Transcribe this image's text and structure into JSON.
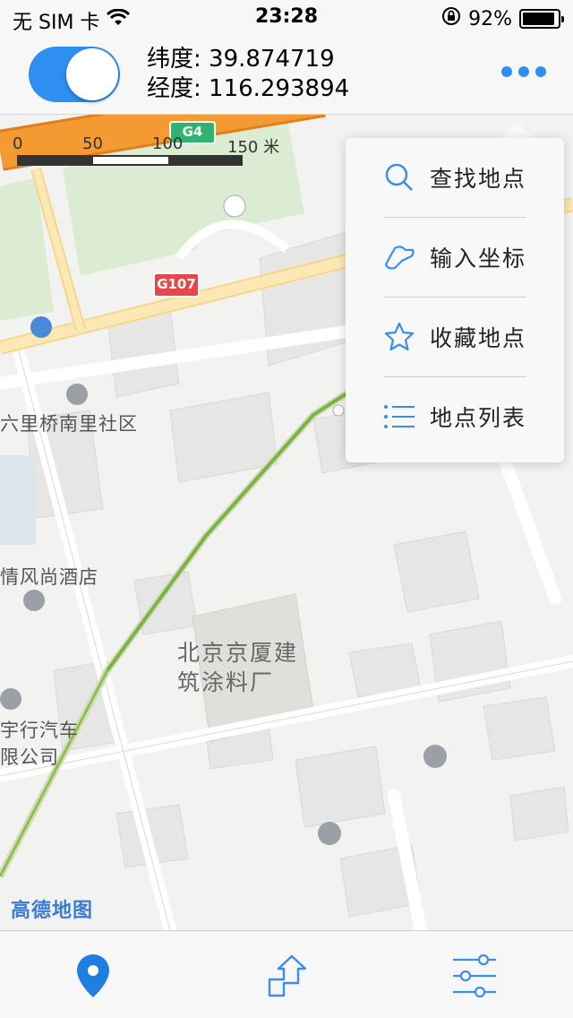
{
  "status_bar": {
    "carrier": "无 SIM 卡",
    "time": "23:28",
    "battery": "92%",
    "battery_level": 0.92
  },
  "header": {
    "location_toggle_on": true,
    "latitude": "纬度: 39.874719",
    "longitude": "经度: 116.293894"
  },
  "map": {
    "scale": {
      "t0": "0",
      "t1": "50",
      "t2": "100",
      "t3": "150 米"
    },
    "road_badges": {
      "g4": "G4",
      "g107": "G107"
    },
    "pois": {
      "community": "六里桥南里社区",
      "hotel": "情风尚酒店",
      "factory_line1": "北京京厦建",
      "factory_line2": "筑涂料厂",
      "car_line1": "宇行汽车",
      "car_line2": "限公司"
    },
    "logo": "高德地图"
  },
  "menu": {
    "items": [
      {
        "label": "查找地点",
        "icon": "search-icon"
      },
      {
        "label": "输入坐标",
        "icon": "pin-input-icon"
      },
      {
        "label": "收藏地点",
        "icon": "star-icon"
      },
      {
        "label": "地点列表",
        "icon": "list-icon"
      }
    ]
  },
  "tabbar": {
    "tabs": [
      {
        "icon": "location-pin-icon",
        "active": true
      },
      {
        "icon": "route-icon",
        "active": false
      },
      {
        "icon": "settings-sliders-icon",
        "active": false
      }
    ]
  },
  "colors": {
    "accent": "#2e8ff0",
    "highway": "#f39a33",
    "road": "#fbe8b5",
    "green": "#dcecd2",
    "building": "#e8e8e6",
    "rail": "#7cb342"
  }
}
